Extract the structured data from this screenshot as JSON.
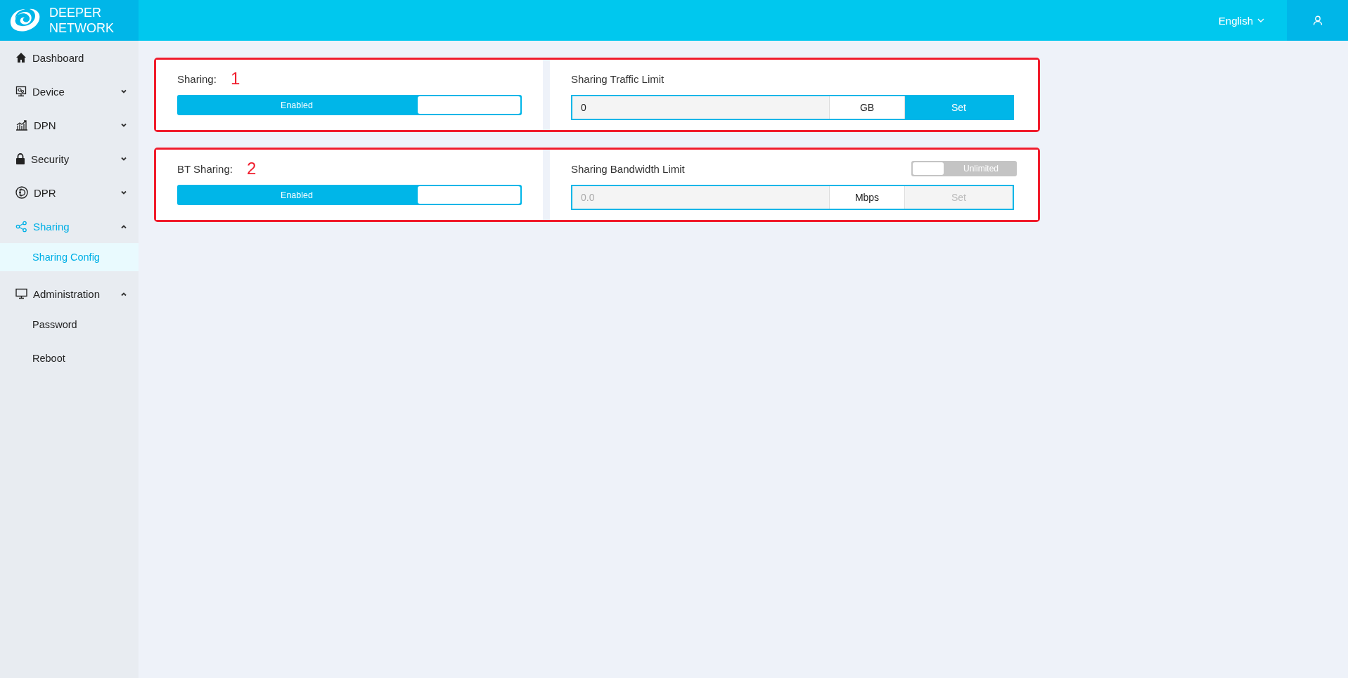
{
  "header": {
    "logo_lines": [
      "DEEPER",
      "NETWORK"
    ],
    "language": "English"
  },
  "sidebar": {
    "items": [
      {
        "label": "Dashboard",
        "selected": false
      },
      {
        "label": "Device",
        "selected": false,
        "expanded": false
      },
      {
        "label": "DPN",
        "selected": false,
        "expanded": false
      },
      {
        "label": "Security",
        "selected": false,
        "expanded": false
      },
      {
        "label": "DPR",
        "selected": false,
        "expanded": false
      },
      {
        "label": "Sharing",
        "selected": true,
        "expanded": true,
        "children": [
          {
            "label": "Sharing Config",
            "selected": true
          }
        ]
      },
      {
        "label": "Administration",
        "selected": false,
        "expanded": true,
        "children": [
          {
            "label": "Password",
            "selected": false
          },
          {
            "label": "Reboot",
            "selected": false
          }
        ]
      }
    ]
  },
  "cards": [
    {
      "annotation": "1",
      "toggle": {
        "label": "Sharing:",
        "text": "Enabled",
        "on": true
      },
      "limit": {
        "title": "Sharing Traffic Limit",
        "value": "0",
        "unit": "GB",
        "button": "Set",
        "disabled": false
      }
    },
    {
      "annotation": "2",
      "toggle": {
        "label": "BT Sharing:",
        "text": "Enabled",
        "on": true
      },
      "limit": {
        "title": "Sharing Bandwidth Limit",
        "switch": {
          "text": "Unlimited",
          "on": false
        },
        "value": "0.0",
        "unit": "Mbps",
        "button": "Set",
        "disabled": true
      }
    }
  ]
}
